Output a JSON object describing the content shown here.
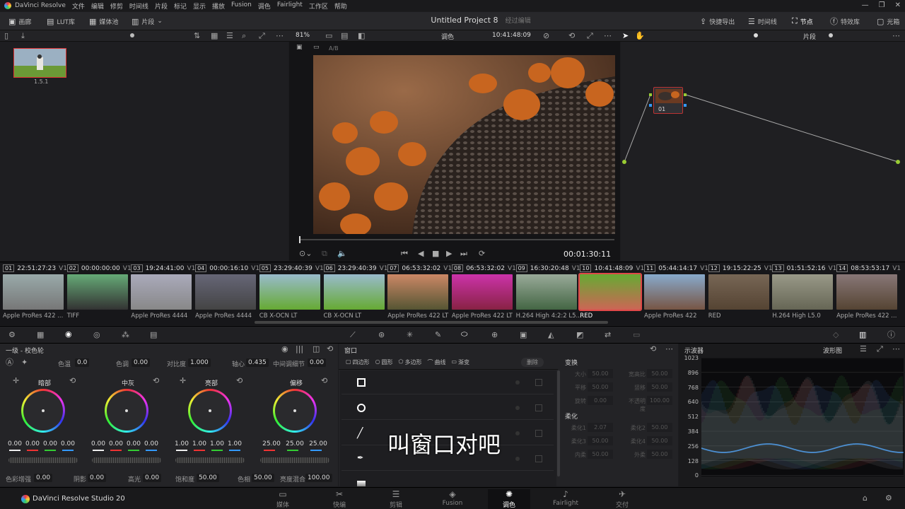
{
  "menubar": {
    "app": "DaVinci Resolve",
    "items": [
      "文件",
      "编辑",
      "修剪",
      "时间线",
      "片段",
      "标记",
      "显示",
      "播放",
      "Fusion",
      "调色",
      "Fairlight",
      "工作区",
      "帮助"
    ]
  },
  "toolbar": {
    "left": [
      {
        "label": "画廊",
        "icon": "gallery-icon"
      },
      {
        "label": "LUT库",
        "icon": "lut-icon"
      },
      {
        "label": "媒体池",
        "icon": "media-pool-icon"
      },
      {
        "label": "片段",
        "icon": "clips-icon"
      }
    ],
    "project_title": "Untitled Project 8",
    "project_status": "经过编辑",
    "right": [
      {
        "label": "快捷导出",
        "icon": "export-icon"
      },
      {
        "label": "时间线",
        "icon": "timeline-icon"
      },
      {
        "label": "节点",
        "icon": "nodes-icon"
      },
      {
        "label": "特效库",
        "icon": "fx-icon"
      },
      {
        "label": "光箱",
        "icon": "lightbox-icon"
      }
    ]
  },
  "viewer": {
    "zoom": "81%",
    "mode": "调色",
    "timecode": "10:41:48:09",
    "ab": "A/B",
    "duration": "00:01:30:11",
    "node_mode": "片段"
  },
  "gallery": {
    "still_label": "1.5.1"
  },
  "node": {
    "label": "01"
  },
  "clips": [
    {
      "num": "01",
      "tc": "22:51:27:23",
      "track": "V1",
      "codec": "Apple ProRes 422 ..."
    },
    {
      "num": "02",
      "tc": "00:00:00:00",
      "track": "V1",
      "codec": "TIFF"
    },
    {
      "num": "03",
      "tc": "19:24:41:00",
      "track": "V1",
      "codec": "Apple ProRes 4444"
    },
    {
      "num": "04",
      "tc": "00:00:16:10",
      "track": "V1",
      "codec": "Apple ProRes 4444"
    },
    {
      "num": "05",
      "tc": "23:29:40:39",
      "track": "V1",
      "codec": "CB X-OCN LT"
    },
    {
      "num": "06",
      "tc": "23:29:40:39",
      "track": "V1",
      "codec": "CB X-OCN LT"
    },
    {
      "num": "07",
      "tc": "06:53:32:02",
      "track": "V1",
      "codec": "Apple ProRes 422 LT"
    },
    {
      "num": "08",
      "tc": "06:53:32:02",
      "track": "V1",
      "codec": "Apple ProRes 422 LT"
    },
    {
      "num": "09",
      "tc": "16:30:20:48",
      "track": "V1",
      "codec": "H.264 High 4:2:2 L5..."
    },
    {
      "num": "10",
      "tc": "10:41:48:09",
      "track": "V1",
      "codec": "RED"
    },
    {
      "num": "11",
      "tc": "05:44:14:17",
      "track": "V1",
      "codec": "Apple ProRes 422"
    },
    {
      "num": "12",
      "tc": "19:15:22:25",
      "track": "V1",
      "codec": "RED"
    },
    {
      "num": "13",
      "tc": "01:51:52:16",
      "track": "V1",
      "codec": "H.264 High L5.0"
    },
    {
      "num": "14",
      "tc": "08:53:53:17",
      "track": "V1",
      "codec": "Apple ProRes 422 ..."
    }
  ],
  "wheels": {
    "title": "一级 - 校色轮",
    "top": {
      "temp_label": "色温",
      "temp": "0.0",
      "tint_label": "色调",
      "tint": "0.00",
      "contrast_label": "对比度",
      "contrast": "1.000",
      "pivot_label": "轴心",
      "pivot": "0.435",
      "middetail_label": "中间调细节",
      "middetail": "0.00"
    },
    "list": [
      {
        "name": "暗部",
        "values": [
          "0.00",
          "0.00",
          "0.00",
          "0.00"
        ]
      },
      {
        "name": "中灰",
        "values": [
          "0.00",
          "0.00",
          "0.00",
          "0.00"
        ]
      },
      {
        "name": "亮部",
        "values": [
          "1.00",
          "1.00",
          "1.00",
          "1.00"
        ]
      },
      {
        "name": "偏移",
        "values": [
          "25.00",
          "25.00",
          "25.00"
        ]
      }
    ],
    "bottom": {
      "boost_label": "色彩增强",
      "boost": "0.00",
      "shadow_label": "阴影",
      "shadow": "0.00",
      "hl_label": "高光",
      "hl": "0.00",
      "sat_label": "饱和度",
      "sat": "50.00",
      "hue_label": "色相",
      "hue": "50.00",
      "lummix_label": "亮度混合",
      "lummix": "100.00"
    }
  },
  "window": {
    "title": "窗口",
    "tools": [
      "四边形",
      "圆形",
      "多边形",
      "曲线",
      "渐变"
    ],
    "delete": "删除",
    "transform_title": "变换",
    "transform": [
      {
        "l": "大小",
        "v": "50.00"
      },
      {
        "l": "宽高比",
        "v": "50.00"
      },
      {
        "l": "平移",
        "v": "50.00"
      },
      {
        "l": "竖移",
        "v": "50.00"
      },
      {
        "l": "旋转",
        "v": "0.00"
      },
      {
        "l": "不透明度",
        "v": "100.00"
      }
    ],
    "soft_title": "柔化",
    "soft": [
      {
        "l": "柔化1",
        "v": "2.07"
      },
      {
        "l": "柔化2",
        "v": "50.00"
      },
      {
        "l": "柔化3",
        "v": "50.00"
      },
      {
        "l": "柔化4",
        "v": "50.00"
      },
      {
        "l": "内柔",
        "v": "50.00"
      },
      {
        "l": "外柔",
        "v": "50.00"
      }
    ]
  },
  "subtitle": "叫窗口对吧",
  "scope": {
    "title": "示波器",
    "mode": "波形图",
    "ticks": [
      "1023",
      "896",
      "768",
      "640",
      "512",
      "384",
      "256",
      "128",
      "0"
    ]
  },
  "pages": [
    {
      "label": "媒体",
      "icon": "media-icon"
    },
    {
      "label": "快编",
      "icon": "cut-icon"
    },
    {
      "label": "剪辑",
      "icon": "edit-icon"
    },
    {
      "label": "Fusion",
      "icon": "fusion-icon"
    },
    {
      "label": "调色",
      "icon": "color-icon"
    },
    {
      "label": "Fairlight",
      "icon": "fairlight-icon"
    },
    {
      "label": "交付",
      "icon": "deliver-icon"
    }
  ],
  "brand": "DaVinci Resolve Studio 20",
  "colors": {
    "accent": "#e04848",
    "active_page": "#ffffff"
  }
}
